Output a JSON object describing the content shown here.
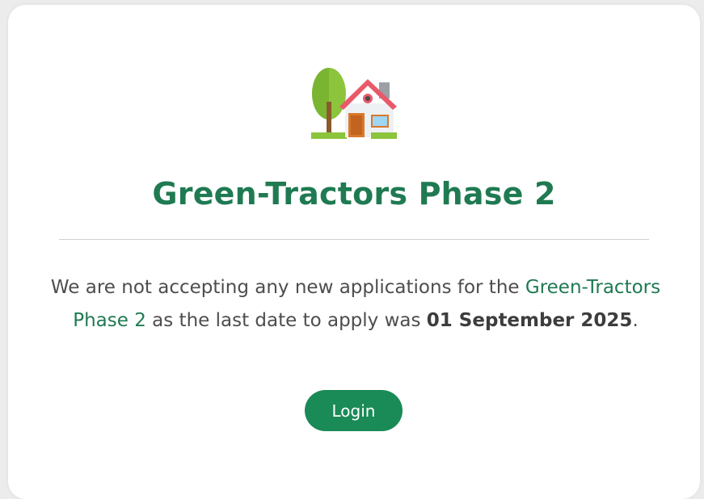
{
  "notice": {
    "title": "Green-Tractors Phase 2",
    "message_prefix": "We are not accepting any new applications for the ",
    "program_name": "Green-Tractors Phase 2",
    "message_middle": " as the last date to apply was ",
    "deadline": "01 September 2025",
    "message_suffix": ".",
    "login_label": "Login"
  },
  "colors": {
    "accent": "#1f7a52",
    "button": "#1a8a57",
    "text": "#4d4d4d"
  },
  "icons": {
    "illustration": "house-with-tree-icon"
  }
}
